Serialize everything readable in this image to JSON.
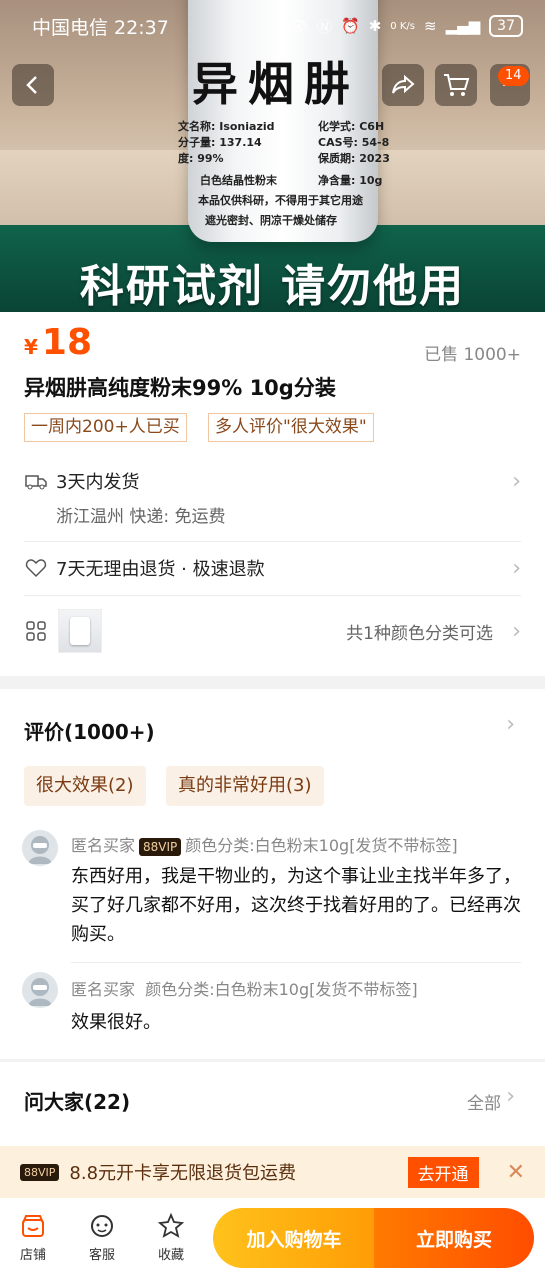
{
  "status_bar": {
    "carrier_time": "中国电信 22:37",
    "speed": "0 K/s",
    "battery": "37"
  },
  "hero": {
    "bottle_label_title": "异烟肼",
    "label_lines": [
      "文名称: Isoniazid",
      "分子量: 137.14",
      "度: 99%",
      "白色结晶性粉末",
      "本品仅供科研，不得用于其它用途",
      "遮光密封、阴凉干燥处储存",
      "化学式: C6H",
      "CAS号: 54-8",
      "保质期: 2023",
      "净含量: 10g"
    ],
    "banner": "科研试剂 请勿他用",
    "cart_badge": "14",
    "icons": [
      "back-icon",
      "share-icon",
      "cart-icon"
    ]
  },
  "product": {
    "currency": "¥",
    "price": "18",
    "sold": "已售 1000+",
    "title": "异烟肼高纯度粉末99%  10g分装",
    "tags": [
      "一周内200+人已买",
      "多人评价\"很大效果\""
    ]
  },
  "shipping": {
    "title": "3天内发货",
    "detail": "浙江温州  快递: 免运费"
  },
  "returns": {
    "title": "7天无理由退货 · 极速退款"
  },
  "variants": {
    "summary": "共1种颜色分类可选"
  },
  "reviews": {
    "title": "评价(1000+)",
    "chips": [
      "很大效果(2)",
      "真的非常好用(3)"
    ],
    "items": [
      {
        "user": "匿名买家",
        "vip": "88VIP",
        "spec": "颜色分类:白色粉末10g[发货不带标签]",
        "text": "东西好用，我是干物业的，为这个事让业主找半年多了，买了好几家都不好用，这次终于找着好用的了。已经再次购买。"
      },
      {
        "user": "匿名买家",
        "spec": "颜色分类:白色粉末10g[发货不带标签]",
        "text": "效果很好。"
      }
    ]
  },
  "qa": {
    "title": "问大家(22)",
    "all": "全部"
  },
  "vip_bar": {
    "tag": "88VIP",
    "text": "8.8元开卡享无限退货包运费",
    "button": "去开通"
  },
  "bottom_bar": {
    "shop": "店铺",
    "service": "客服",
    "favorite": "收藏",
    "add_cart": "加入购物车",
    "buy_now": "立即购买"
  },
  "colors": {
    "accent": "#ff5000",
    "cart_button": "#ffa20e",
    "tag_border": "#f1c7a3",
    "chip_bg": "#fbf0e6"
  }
}
